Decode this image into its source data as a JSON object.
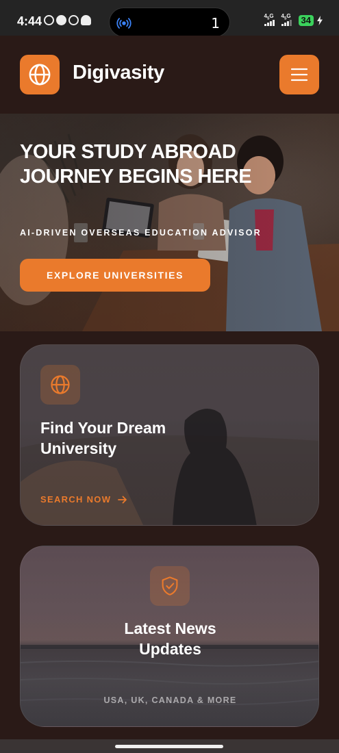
{
  "status_bar": {
    "time": "4:44",
    "island_count": "1",
    "signal1_label": "4.5G",
    "signal2_label": "4.5G",
    "battery": "34"
  },
  "header": {
    "brand": "Digivasity",
    "logo_icon": "globe-icon",
    "menu_icon": "hamburger-icon"
  },
  "hero": {
    "title": "YOUR STUDY ABROAD JOURNEY BEGINS HERE",
    "subtitle": "AI-DRIVEN OVERSEAS EDUCATION ADVISOR",
    "cta_label": "EXPLORE UNIVERSITIES"
  },
  "cards": [
    {
      "icon": "globe-icon",
      "title": "Find Your Dream University",
      "link_label": "SEARCH NOW",
      "link_icon": "arrow-right-icon"
    },
    {
      "icon": "shield-check-icon",
      "title": "Latest News Updates",
      "tags": "USA, UK, CANADA & MORE"
    }
  ],
  "colors": {
    "accent": "#ea7a2c",
    "background": "#2a1a17"
  }
}
